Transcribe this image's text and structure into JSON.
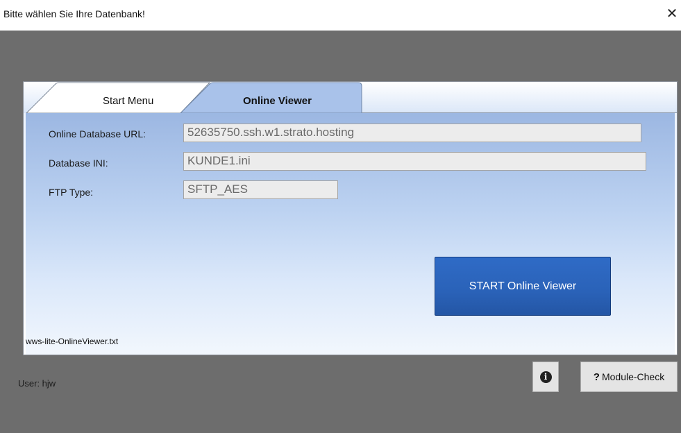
{
  "window": {
    "title": "Bitte wählen Sie Ihre Datenbank!",
    "close_glyph": "✕"
  },
  "tabs": [
    {
      "label": "Start Menu",
      "active": false
    },
    {
      "label": "Online Viewer",
      "active": true
    }
  ],
  "form": {
    "url_label": "Online Database URL:",
    "url_value": "52635750.ssh.w1.strato.hosting",
    "ini_label": "Database INI:",
    "ini_value": "KUNDE1.ini",
    "ftp_label": "FTP Type:",
    "ftp_value": "SFTP_AES"
  },
  "start_button_label": "START Online Viewer",
  "footer_file": "wws-lite-OnlineViewer.txt",
  "status": {
    "user": "User: hjw"
  },
  "buttons": {
    "info_glyph": "i",
    "module_check_prefix": "?",
    "module_check_label": "Module-Check"
  },
  "colors": {
    "background": "#6d6d6d",
    "accent": "#2a62b8"
  },
  "icons": {
    "close": "close-icon",
    "info": "info-icon",
    "question": "question-icon"
  }
}
